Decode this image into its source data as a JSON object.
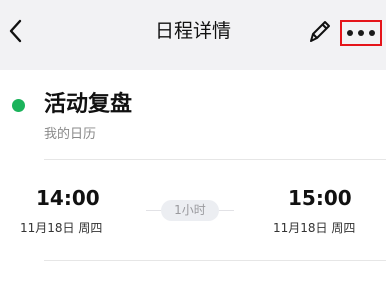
{
  "header": {
    "title": "日程详情",
    "back_icon": "chevron-left-icon",
    "edit_icon": "pencil-icon",
    "more_icon": "more-horizontal-icon",
    "more_highlight_color": "#e5141a"
  },
  "event": {
    "title": "活动复盘",
    "calendar": "我的日历",
    "status_color": "#1bb35b",
    "start": {
      "time": "14:00",
      "date": "11月18日 周四"
    },
    "end": {
      "time": "15:00",
      "date": "11月18日 周四"
    },
    "duration": "1小时"
  }
}
